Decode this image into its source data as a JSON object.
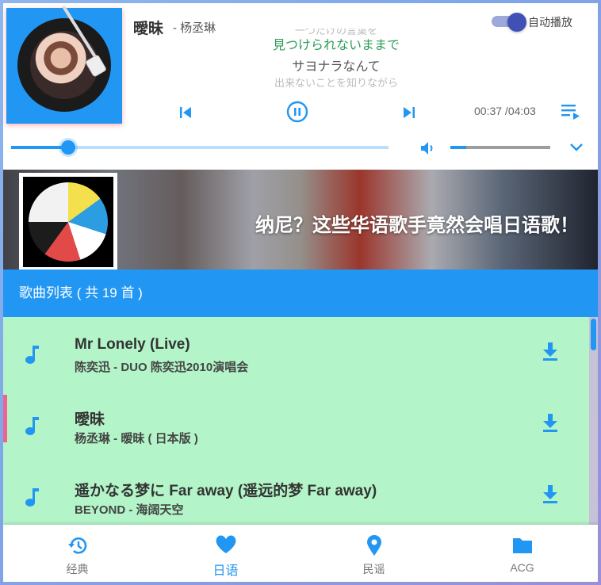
{
  "player": {
    "song_title": "曖昧",
    "song_artist": "- 杨丞琳",
    "lyrics": {
      "prev_line": "一つだけの言葉を",
      "current_line": "見つけられないままで",
      "next_line": "サヨナラなんて",
      "after_line": "出来ないことを知りながら"
    },
    "autoplay": {
      "label": "自动播放",
      "enabled": true
    },
    "time": "00:37 /04:03",
    "progress": 0.152,
    "volume": 0.16,
    "icons": {
      "prev": "skip-previous-icon",
      "pause": "pause-circle-icon",
      "next": "skip-next-icon",
      "playlist": "playlist-play-icon",
      "volume": "volume-icon",
      "expand": "chevron-down-icon"
    }
  },
  "banner": {
    "title": "纳尼？这些华语歌手竟然会唱日语歌！"
  },
  "list": {
    "header": "歌曲列表 ( 共 19 首 )",
    "songs": [
      {
        "title": "Mr Lonely (Live)",
        "subtitle": "陈奕迅 - DUO 陈奕迅2010演唱会",
        "active": false
      },
      {
        "title": "曖昧",
        "subtitle": "杨丞琳 - 暧昧 ( 日本版 )",
        "active": true
      },
      {
        "title": "遥かなる梦に Far away (遥远的梦 Far away)",
        "subtitle": "BEYOND - 海阔天空",
        "active": false
      }
    ]
  },
  "nav": {
    "items": [
      {
        "label": "经典",
        "icon": "history-icon"
      },
      {
        "label": "日语",
        "icon": "heart-icon"
      },
      {
        "label": "民谣",
        "icon": "location-pin-icon"
      },
      {
        "label": "ACG",
        "icon": "folder-icon"
      }
    ],
    "active_index": 1
  },
  "colors": {
    "primary": "#2196f3",
    "list_background": "#b3f5c8",
    "active_lyric": "#2e9e5a",
    "active_marker": "#f06292",
    "toggle": "#3f51b5"
  }
}
